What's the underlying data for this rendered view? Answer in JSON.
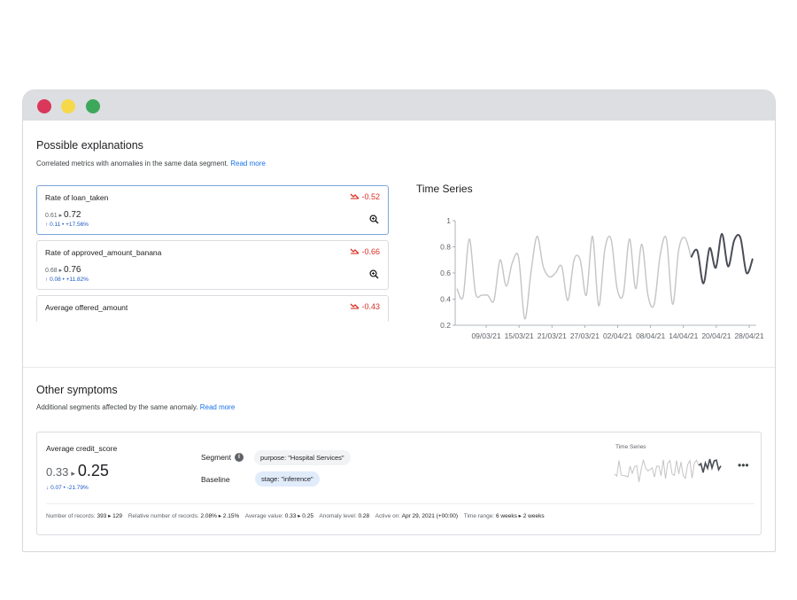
{
  "explanations": {
    "title": "Possible explanations",
    "subtitle": "Correlated metrics with anomalies in the same data segment.",
    "read_more": "Read more",
    "cards": [
      {
        "title": "Rate of loan_taken",
        "change": "-0.52",
        "from": "0.61",
        "to": "0.72",
        "delta": "0.11 • +17.56%"
      },
      {
        "title": "Rate of approved_amount_banana",
        "change": "-0.66",
        "from": "0.68",
        "to": "0.76",
        "delta": "0.08 • +11.82%"
      },
      {
        "title": "Average offered_amount",
        "change": "-0.43",
        "from": "",
        "to": "",
        "delta": ""
      }
    ]
  },
  "chart_data": {
    "type": "line",
    "title": "Time Series",
    "x": [
      "09/03/21",
      "15/03/21",
      "21/03/21",
      "27/03/21",
      "02/04/21",
      "08/04/21",
      "14/04/21",
      "20/04/21",
      "28/04/21"
    ],
    "ylim": [
      0.2,
      1.0
    ],
    "yticks": [
      "1",
      "0.8",
      "0.6",
      "0.4",
      "0.2"
    ],
    "series": [
      {
        "role": "history",
        "values": [
          0.48,
          0.42,
          0.86,
          0.45,
          0.43,
          0.43,
          0.39,
          0.7,
          0.5,
          0.68,
          0.72,
          0.25,
          0.6,
          0.88,
          0.65,
          0.57,
          0.6,
          0.65,
          0.39,
          0.7,
          0.7,
          0.43,
          0.88,
          0.35,
          0.78,
          0.86,
          0.48,
          0.44,
          0.86,
          0.48,
          0.82,
          0.43,
          0.36,
          0.74,
          0.86,
          0.36,
          0.78,
          0.87,
          0.72
        ]
      },
      {
        "role": "anomaly",
        "values": [
          0.72,
          0.77,
          0.52,
          0.79,
          0.64,
          0.9,
          0.65,
          0.85,
          0.87,
          0.6,
          0.71
        ]
      }
    ],
    "colors": {
      "history": "#c4c4c4",
      "anomaly": "#4a4d57"
    }
  },
  "symptoms": {
    "title": "Other symptoms",
    "subtitle": "Additional segments affected by the same anomaly.",
    "read_more": "Read more",
    "metric": "Average credit_score",
    "from": "0.33",
    "to": "0.25",
    "delta": "0.07 • -21.79%",
    "segment_label": "Segment",
    "segment_value": "purpose: \"Hospital Services\"",
    "baseline_label": "Baseline",
    "baseline_value": "stage: \"inference\"",
    "mini_title": "Time Series",
    "more": "•••",
    "footer": [
      {
        "label": "Number of records:",
        "value": "393 ▸ 129"
      },
      {
        "label": "Relative number of records:",
        "value": "2.08% ▸ 2.15%"
      },
      {
        "label": "Average value:",
        "value": "0.33 ▸ 0.25"
      },
      {
        "label": "Anomaly level:",
        "value": "0.28"
      },
      {
        "label": "Active on:",
        "value": "Apr 29, 2021 (+00:00)"
      },
      {
        "label": "Time range:",
        "value": "6 weeks ▸ 2 weeks"
      }
    ]
  }
}
